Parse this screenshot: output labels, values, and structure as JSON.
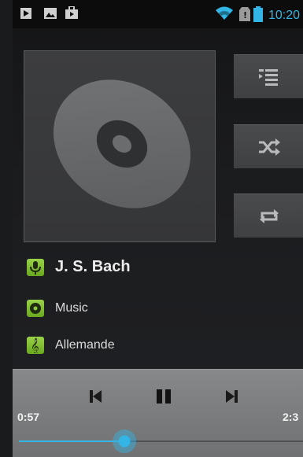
{
  "status_bar": {
    "time": "10:20",
    "icons": [
      "media-play-icon",
      "gallery-icon",
      "shopping-bag-icon",
      "wifi-icon",
      "no-sim-icon",
      "battery-icon"
    ]
  },
  "now_playing": {
    "artist": "J. S. Bach",
    "album": "Music",
    "track": "Allemande"
  },
  "side_buttons": [
    "queue-list-icon",
    "shuffle-icon",
    "repeat-icon"
  ],
  "playback": {
    "elapsed": "0:57",
    "total": "2:3",
    "progress": 0.37,
    "controls": [
      "previous-icon",
      "pause-icon",
      "next-icon"
    ]
  },
  "colors": {
    "accent": "#33b5e5",
    "icon_green": "#8cc63f"
  }
}
